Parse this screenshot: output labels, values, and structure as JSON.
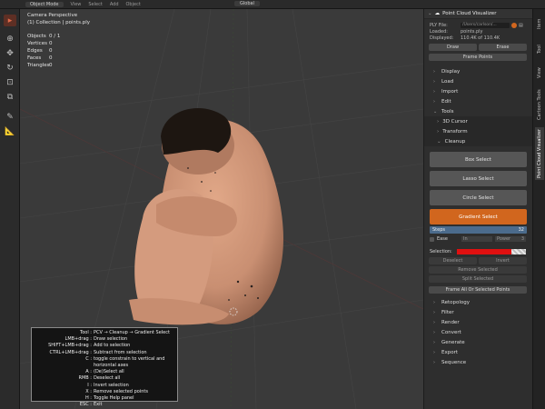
{
  "header": {
    "mode": "Object Mode",
    "menus": [
      "View",
      "Select",
      "Add",
      "Object"
    ],
    "orientation": "Global"
  },
  "viewport": {
    "perspective": "Camera Perspective",
    "collection": "(1) Collection | points.ply",
    "stats": [
      {
        "label": "Objects",
        "value": "0 / 1"
      },
      {
        "label": "Vertices",
        "value": "0"
      },
      {
        "label": "Edges",
        "value": "0"
      },
      {
        "label": "Faces",
        "value": "0"
      },
      {
        "label": "Triangles",
        "value": "0"
      }
    ]
  },
  "help": {
    "rows": [
      {
        "k": "Tool :",
        "v": "PCV → Cleanup → Gradient Select"
      },
      {
        "k": "LMB+drag :",
        "v": "Draw selection"
      },
      {
        "k": "SHIFT+LMB+drag :",
        "v": "Add to selection"
      },
      {
        "k": "CTRL+LMB+drag :",
        "v": "Subtract from selection"
      },
      {
        "k": "C :",
        "v": "toggle constrain to vertical and horizontal axes"
      },
      {
        "k": "A :",
        "v": "(De)Select all"
      },
      {
        "k": "RMB :",
        "v": "Deselect all"
      },
      {
        "k": "I :",
        "v": "Invert selection"
      },
      {
        "k": "X :",
        "v": "Remove selected points"
      },
      {
        "k": "H :",
        "v": "Toggle Help panel"
      },
      {
        "k": "ESC :",
        "v": "Exit"
      }
    ]
  },
  "vtabs": [
    "Item",
    "Tool",
    "View",
    "Cartoon Tools",
    "Point Cloud Visualizer"
  ],
  "panel": {
    "title": "Point Cloud Visualizer",
    "ply_label": "PLY File:",
    "ply_value": "/Users/carlson/...",
    "loaded_label": "Loaded:",
    "loaded_value": "points.ply",
    "displayed_label": "Displayed:",
    "displayed_value": "110.4K of 110.4K",
    "draw": "Draw",
    "erase": "Erase",
    "frame_points": "Frame Points",
    "sections_top": [
      "Display",
      "Load",
      "Import",
      "Edit",
      "Tools"
    ],
    "tools_sub": [
      "3D Cursor",
      "Transform",
      "Cleanup"
    ],
    "box_select": "Box Select",
    "lasso_select": "Lasso Select",
    "circle_select": "Circle Select",
    "gradient_select": "Gradient Select",
    "steps_label": "Steps",
    "steps_value": "32",
    "ease_label": "Ease",
    "ease_mode": "In",
    "power_label": "Power",
    "power_value": "3",
    "selection_label": "Selection:",
    "deselect": "Deselect",
    "invert": "Invert",
    "remove_selected": "Remove Selected",
    "split_selected": "Split Selected",
    "frame_all": "Frame All Or Selected Points",
    "sections_bottom": [
      "Retopology",
      "Filter",
      "Render",
      "Convert",
      "Generate",
      "Export",
      "Sequence"
    ]
  },
  "colors": {
    "accent": "#d1661e",
    "selection": "#e01010",
    "viewport_bg": "#3a3a3a",
    "figure": "#c98f72"
  }
}
